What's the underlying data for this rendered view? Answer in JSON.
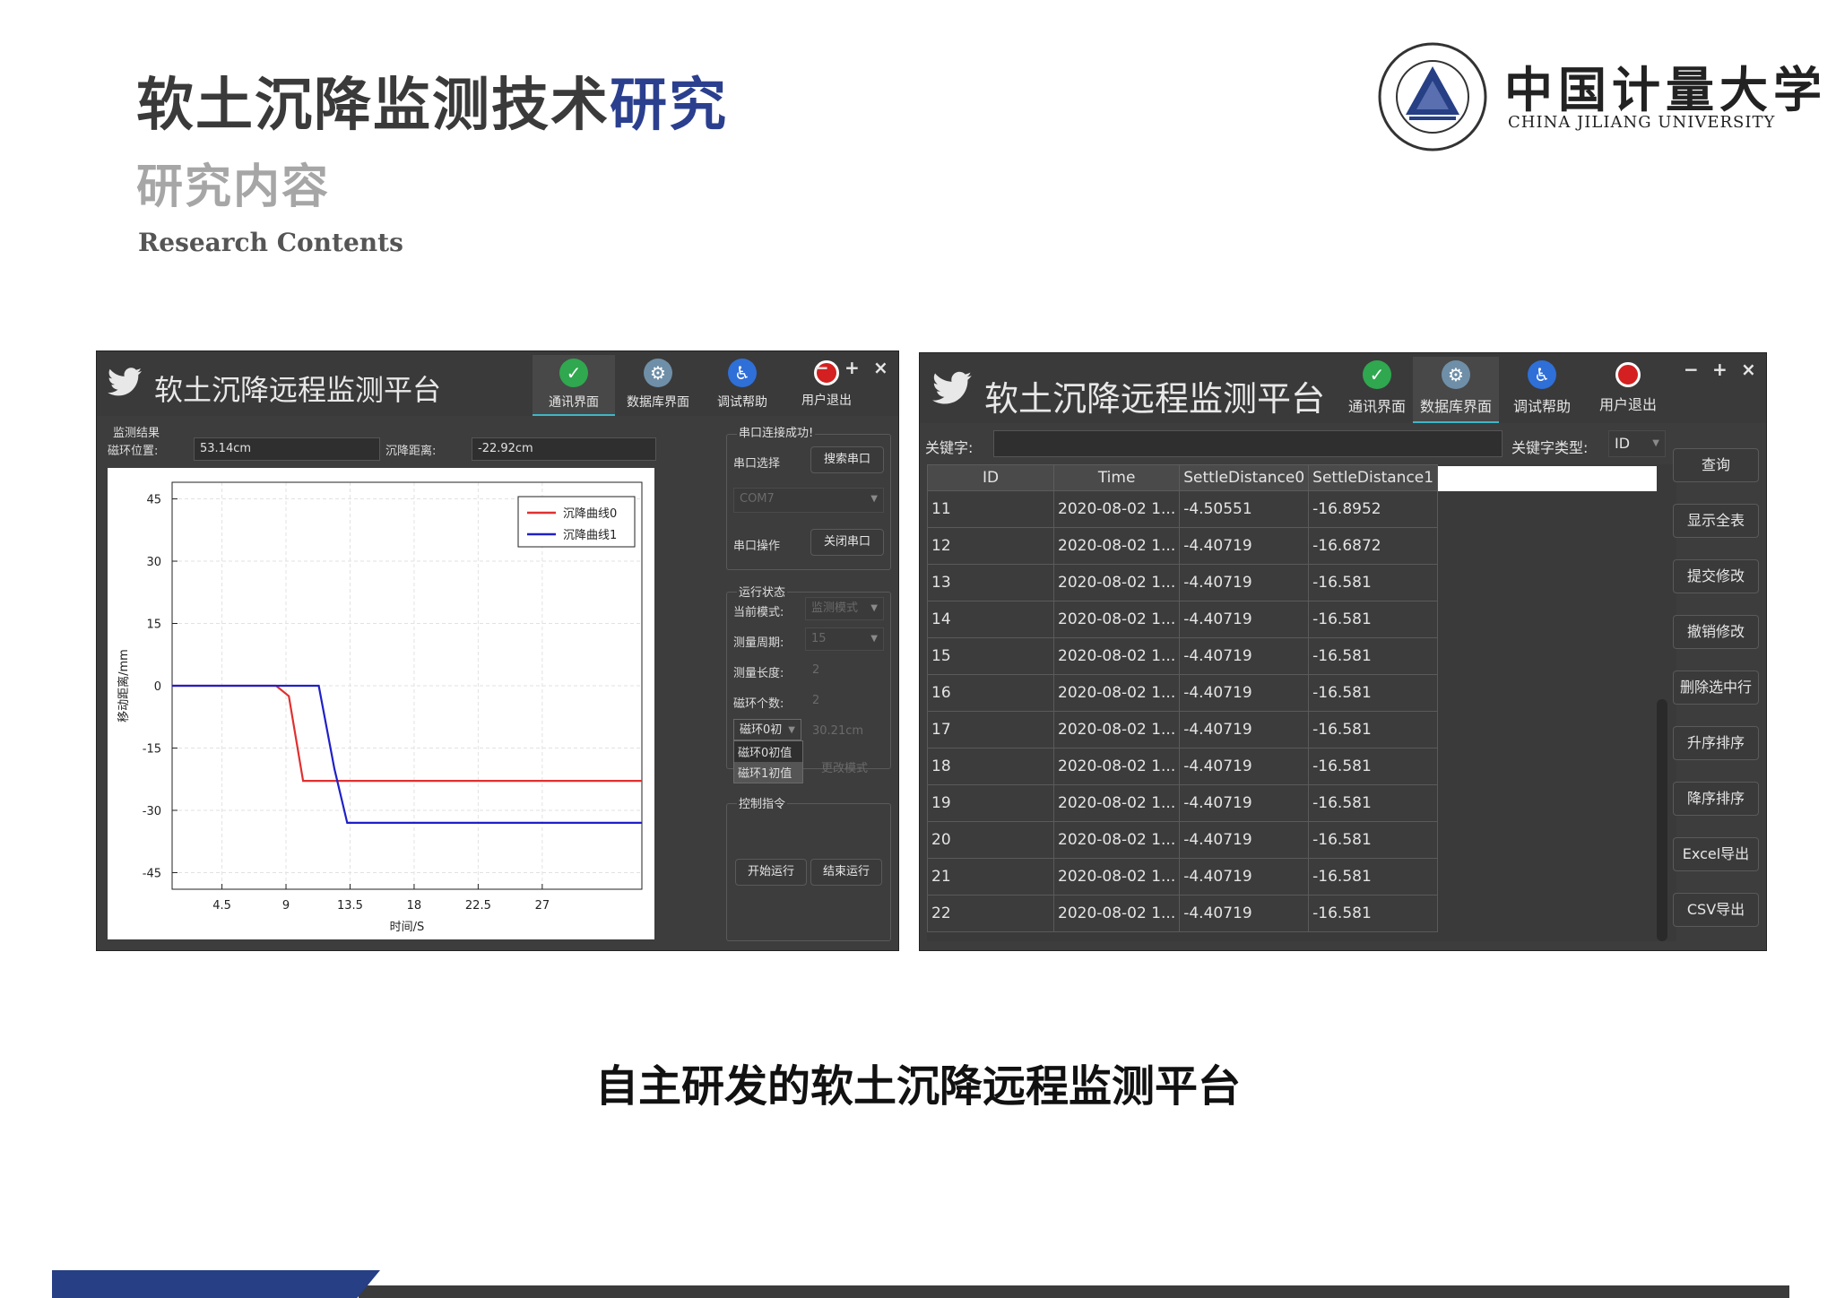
{
  "slide": {
    "title_main": "软土沉降监测技术",
    "title_highlight": "研究",
    "subtitle": "研究内容",
    "subtitle_en": "Research Contents",
    "logo_cn": "中国计量大学",
    "logo_en": "CHINA JILIANG UNIVERSITY",
    "caption": "自主研发的软土沉降远程监测平台"
  },
  "colors": {
    "title_highlight": "#2b3f8f",
    "footer_blue": "#263f85",
    "window_bg": "#3d3d3d",
    "curve0": "#e03030",
    "curve1": "#2020c8"
  },
  "window_left": {
    "app_title": "软土沉降远程监测平台",
    "tabs": [
      {
        "label": "通讯界面",
        "icon": "shield-icon",
        "active": true
      },
      {
        "label": "数据库界面",
        "icon": "gear-icon",
        "active": false
      },
      {
        "label": "调试帮助",
        "icon": "accessibility-icon",
        "active": false
      },
      {
        "label": "用户退出",
        "icon": "power-icon",
        "active": false
      }
    ],
    "window_controls": {
      "minimize": "−",
      "maximize": "+",
      "close": "×"
    },
    "monitor_group": "监测结果",
    "ring_position_label": "磁环位置:",
    "ring_position_value": "53.14cm",
    "settle_distance_label": "沉降距离:",
    "settle_distance_value": "-22.92cm",
    "serial_group": "串口连接成功!",
    "serial_select_label": "串口选择",
    "search_port_button": "搜索串口",
    "port_value": "COM7",
    "serial_op_label": "串口操作",
    "close_port_button": "关闭串口",
    "run_status_group": "运行状态",
    "current_mode_label": "当前模式:",
    "current_mode_value": "监测模式",
    "measure_period_label": "测量周期:",
    "measure_period_value": "15",
    "measure_length_label": "测量长度:",
    "measure_length_value": "2",
    "ring_count_label": "磁环个数:",
    "ring_count_value": "2",
    "ring_init_combo": "磁环0初",
    "ring_init_value": "30.21cm",
    "ring_init_options": [
      "磁环0初值",
      "磁环1初值"
    ],
    "change_mode_button": "更改模式",
    "control_group": "控制指令",
    "start_button": "开始运行",
    "stop_button": "结束运行"
  },
  "chart_data": {
    "type": "line",
    "xlabel": "时间/S",
    "ylabel": "移动距离/mm",
    "xlim": [
      1,
      34
    ],
    "ylim": [
      -49,
      49
    ],
    "x_ticks": [
      4.5,
      9,
      13.5,
      18,
      22.5,
      27
    ],
    "x_tick_labels": [
      "4.5",
      "9",
      "13.5",
      "18",
      "22.5",
      "27"
    ],
    "y_ticks": [
      45,
      30,
      15,
      0,
      -15,
      -30,
      -45
    ],
    "y_tick_labels": [
      "45",
      "30",
      "15",
      "0",
      "-15",
      "-30",
      "-45"
    ],
    "grid": true,
    "legend_position": "top-right",
    "series": [
      {
        "name": "沉降曲线0",
        "color": "#e03030",
        "x": [
          1,
          8.3,
          9.2,
          10.2,
          34
        ],
        "y": [
          0,
          0,
          -2.5,
          -22.9,
          -22.9
        ]
      },
      {
        "name": "沉降曲线1",
        "color": "#2020c8",
        "x": [
          1,
          11.3,
          12.4,
          13.3,
          34
        ],
        "y": [
          0,
          0,
          -20,
          -33,
          -33
        ]
      }
    ]
  },
  "window_right": {
    "app_title": "软土沉降远程监测平台",
    "tabs": [
      {
        "label": "通讯界面",
        "icon": "shield-icon",
        "active": false
      },
      {
        "label": "数据库界面",
        "icon": "gear-icon",
        "active": true
      },
      {
        "label": "调试帮助",
        "icon": "accessibility-icon",
        "active": false
      },
      {
        "label": "用户退出",
        "icon": "power-icon",
        "active": false
      }
    ],
    "window_controls": {
      "minimize": "−",
      "maximize": "+",
      "close": "×"
    },
    "keyword_label": "关键字:",
    "keyword_value": "",
    "keyword_type_label": "关键字类型:",
    "keyword_type_value": "ID",
    "columns": [
      "ID",
      "Time",
      "SettleDistance0",
      "SettleDistance1"
    ],
    "rows": [
      [
        "11",
        "2020-08-02 1...",
        "-4.50551",
        "-16.8952"
      ],
      [
        "12",
        "2020-08-02 1...",
        "-4.40719",
        "-16.6872"
      ],
      [
        "13",
        "2020-08-02 1...",
        "-4.40719",
        "-16.581"
      ],
      [
        "14",
        "2020-08-02 1...",
        "-4.40719",
        "-16.581"
      ],
      [
        "15",
        "2020-08-02 1...",
        "-4.40719",
        "-16.581"
      ],
      [
        "16",
        "2020-08-02 1...",
        "-4.40719",
        "-16.581"
      ],
      [
        "17",
        "2020-08-02 1...",
        "-4.40719",
        "-16.581"
      ],
      [
        "18",
        "2020-08-02 1...",
        "-4.40719",
        "-16.581"
      ],
      [
        "19",
        "2020-08-02 1...",
        "-4.40719",
        "-16.581"
      ],
      [
        "20",
        "2020-08-02 1...",
        "-4.40719",
        "-16.581"
      ],
      [
        "21",
        "2020-08-02 1...",
        "-4.40719",
        "-16.581"
      ],
      [
        "22",
        "2020-08-02 1...",
        "-4.40719",
        "-16.581"
      ]
    ],
    "side_buttons": [
      "查询",
      "显示全表",
      "提交修改",
      "撤销修改",
      "删除选中行",
      "升序排序",
      "降序排序",
      "Excel导出",
      "CSV导出"
    ]
  }
}
